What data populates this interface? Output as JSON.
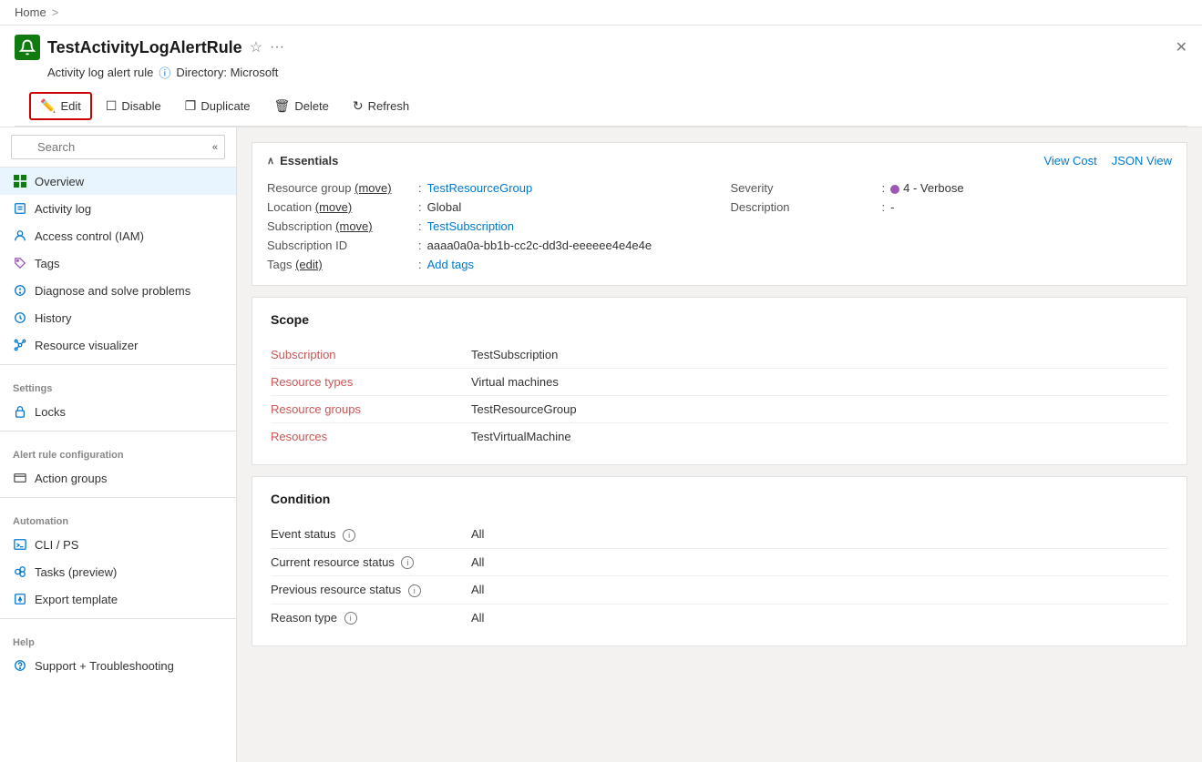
{
  "breadcrumb": {
    "home": "Home",
    "sep": ">"
  },
  "resource": {
    "title": "TestActivityLogAlertRule",
    "subtitle_type": "Activity log alert rule",
    "subtitle_info": "ⓘ",
    "subtitle_directory": "Directory: Microsoft"
  },
  "toolbar": {
    "edit": "Edit",
    "disable": "Disable",
    "duplicate": "Duplicate",
    "delete": "Delete",
    "refresh": "Refresh"
  },
  "sidebar": {
    "search_placeholder": "Search",
    "items": [
      {
        "id": "overview",
        "label": "Overview",
        "icon": "grid",
        "active": true,
        "section": ""
      },
      {
        "id": "activity-log",
        "label": "Activity log",
        "icon": "log",
        "active": false,
        "section": ""
      },
      {
        "id": "access-control",
        "label": "Access control (IAM)",
        "icon": "people",
        "active": false,
        "section": ""
      },
      {
        "id": "tags",
        "label": "Tags",
        "icon": "tag",
        "active": false,
        "section": ""
      },
      {
        "id": "diagnose",
        "label": "Diagnose and solve problems",
        "icon": "wrench",
        "active": false,
        "section": ""
      },
      {
        "id": "history",
        "label": "History",
        "icon": "clock",
        "active": false,
        "section": ""
      },
      {
        "id": "resource-visualizer",
        "label": "Resource visualizer",
        "icon": "visualizer",
        "active": false,
        "section": ""
      }
    ],
    "settings_section": "Settings",
    "settings_items": [
      {
        "id": "locks",
        "label": "Locks",
        "icon": "lock"
      }
    ],
    "alert_section": "Alert rule configuration",
    "alert_items": [
      {
        "id": "action-groups",
        "label": "Action groups",
        "icon": "table"
      }
    ],
    "automation_section": "Automation",
    "automation_items": [
      {
        "id": "cli-ps",
        "label": "CLI / PS",
        "icon": "terminal"
      },
      {
        "id": "tasks",
        "label": "Tasks (preview)",
        "icon": "tasks"
      },
      {
        "id": "export",
        "label": "Export template",
        "icon": "export"
      }
    ],
    "help_section": "Help",
    "help_items": [
      {
        "id": "support",
        "label": "Support + Troubleshooting",
        "icon": "question"
      }
    ]
  },
  "essentials": {
    "title": "Essentials",
    "view_cost": "View Cost",
    "json_view": "JSON View",
    "fields": {
      "resource_group_label": "Resource group (move)",
      "resource_group_value": "TestResourceGroup",
      "severity_label": "Severity",
      "severity_value": "4 - Verbose",
      "location_label": "Location (move)",
      "location_value": "Global",
      "description_label": "Description",
      "description_value": "-",
      "subscription_label": "Subscription (move)",
      "subscription_value": "TestSubscription",
      "subscription_id_label": "Subscription ID",
      "subscription_id_value": "aaaa0a0a-bb1b-cc2c-dd3d-eeeeee4e4e4e",
      "tags_label": "Tags (edit)",
      "tags_value": "Add tags"
    }
  },
  "scope": {
    "title": "Scope",
    "rows": [
      {
        "label": "Subscription",
        "value": "TestSubscription"
      },
      {
        "label": "Resource types",
        "value": "Virtual machines"
      },
      {
        "label": "Resource groups",
        "value": "TestResourceGroup"
      },
      {
        "label": "Resources",
        "value": "TestVirtualMachine"
      }
    ]
  },
  "condition": {
    "title": "Condition",
    "rows": [
      {
        "label": "Event status",
        "value": "All",
        "has_info": true
      },
      {
        "label": "Current resource status",
        "value": "All",
        "has_info": true
      },
      {
        "label": "Previous resource status",
        "value": "All",
        "has_info": true
      },
      {
        "label": "Reason type",
        "value": "All",
        "has_info": true
      }
    ]
  }
}
